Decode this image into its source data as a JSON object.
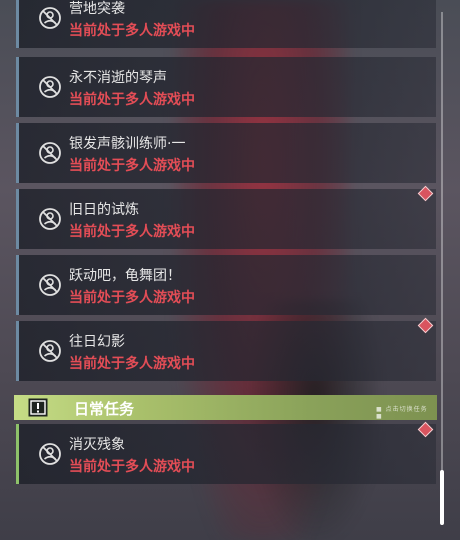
{
  "quests": [
    {
      "title": "营地突袭",
      "status": "当前处于多人游戏中"
    },
    {
      "title": "永不消逝的琴声",
      "status": "当前处于多人游戏中"
    },
    {
      "title": "银发声骸训练师·一",
      "status": "当前处于多人游戏中"
    },
    {
      "title": "旧日的试炼",
      "status": "当前处于多人游戏中"
    },
    {
      "title": "跃动吧，龟舞团！",
      "status": "当前处于多人游戏中"
    },
    {
      "title": "往日幻影",
      "status": "当前处于多人游戏中"
    }
  ],
  "daily_section": {
    "title": "日常任务",
    "icon": "alert-icon",
    "hint": "■ 点击切换任务 ■"
  },
  "daily_quests": [
    {
      "title": "消灭残象",
      "status": "当前处于多人游戏中"
    }
  ],
  "colors": {
    "status": "#e34d56",
    "accent_green": "#a9c06b",
    "marker": "#d9545f"
  }
}
